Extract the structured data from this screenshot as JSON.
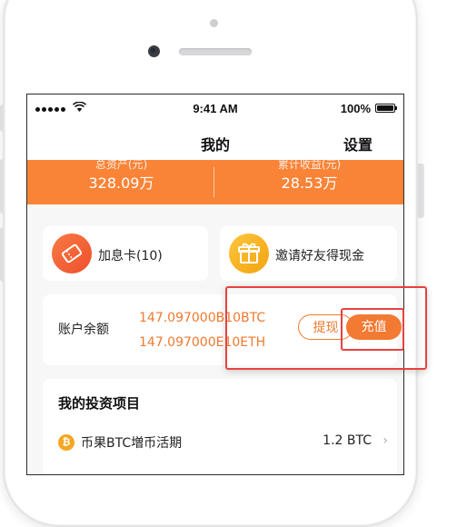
{
  "status_bar": {
    "time": "9:41 AM",
    "battery": "100%"
  },
  "nav": {
    "title": "我的",
    "right_action": "设置"
  },
  "summary": {
    "total_assets_label": "总资产(元)",
    "total_assets_value": "328.09万",
    "cumulative_income_label": "累计收益(元)",
    "cumulative_income_value": "28.53万"
  },
  "features": [
    {
      "label": "加息卡(10)",
      "icon": "ticket-icon",
      "color": "#f3683a"
    },
    {
      "label": "邀请好友得现金",
      "icon": "gift-icon",
      "color": "#f6b11a"
    }
  ],
  "balance": {
    "label": "账户余额",
    "btc": "147.097000B10BTC",
    "eth": "147.097000E10ETH",
    "withdraw_label": "提现",
    "deposit_label": "充值"
  },
  "investments": {
    "title": "我的投资项目",
    "items": [
      {
        "coin_symbol": "₿",
        "name": "币果BTC増币活期",
        "amount": "1.2 BTC"
      }
    ]
  },
  "colors": {
    "accent": "#f98438",
    "highlight": "#e8423f"
  }
}
